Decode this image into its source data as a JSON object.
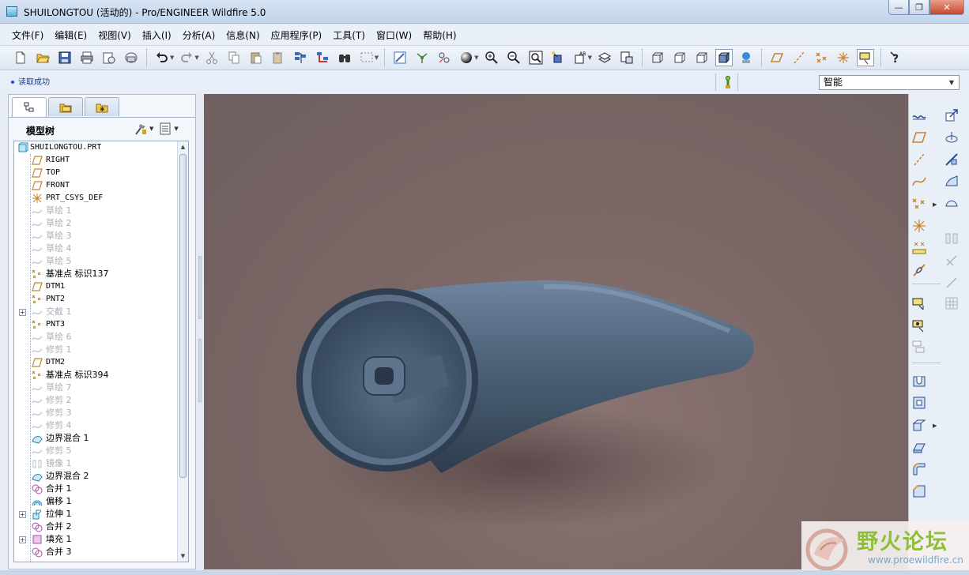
{
  "window": {
    "title": "SHUILONGTOU (活动的) - Pro/ENGINEER Wildfire 5.0",
    "minimize": "—",
    "maximize": "❐",
    "close": "✕"
  },
  "menu": [
    "文件(F)",
    "编辑(E)",
    "视图(V)",
    "插入(I)",
    "分析(A)",
    "信息(N)",
    "应用程序(P)",
    "工具(T)",
    "窗口(W)",
    "帮助(H)"
  ],
  "status": {
    "message": "读取成功",
    "filter_value": "智能"
  },
  "model_tree": {
    "header": "模型树",
    "items": [
      {
        "label": "SHUILONGTOU.PRT",
        "icon": "part-icon",
        "dim": false,
        "expand": false
      },
      {
        "label": "RIGHT",
        "icon": "datum-plane-icon",
        "dim": false,
        "expand": false
      },
      {
        "label": "TOP",
        "icon": "datum-plane-icon",
        "dim": false,
        "expand": false
      },
      {
        "label": "FRONT",
        "icon": "datum-plane-icon",
        "dim": false,
        "expand": false
      },
      {
        "label": "PRT_CSYS_DEF",
        "icon": "csys-icon",
        "dim": false,
        "expand": false
      },
      {
        "label": "草绘 1",
        "icon": "sketch-icon",
        "dim": true,
        "expand": false
      },
      {
        "label": "草绘 2",
        "icon": "sketch-icon",
        "dim": true,
        "expand": false
      },
      {
        "label": "草绘 3",
        "icon": "sketch-icon",
        "dim": true,
        "expand": false
      },
      {
        "label": "草绘 4",
        "icon": "sketch-icon",
        "dim": true,
        "expand": false
      },
      {
        "label": "草绘 5",
        "icon": "sketch-icon",
        "dim": true,
        "expand": false
      },
      {
        "label": "基准点 标识137",
        "icon": "datum-point-icon",
        "dim": false,
        "expand": false
      },
      {
        "label": "DTM1",
        "icon": "datum-plane-icon",
        "dim": false,
        "expand": false
      },
      {
        "label": "PNT2",
        "icon": "datum-point-icon",
        "dim": false,
        "expand": false
      },
      {
        "label": "交截 1",
        "icon": "intersect-icon",
        "dim": true,
        "expand": true
      },
      {
        "label": "PNT3",
        "icon": "datum-point-icon",
        "dim": false,
        "expand": false
      },
      {
        "label": "草绘 6",
        "icon": "sketch-icon",
        "dim": true,
        "expand": false
      },
      {
        "label": "修剪 1",
        "icon": "trim-icon",
        "dim": true,
        "expand": false
      },
      {
        "label": "DTM2",
        "icon": "datum-plane-icon",
        "dim": false,
        "expand": false
      },
      {
        "label": "基准点 标识394",
        "icon": "datum-point-icon",
        "dim": false,
        "expand": false
      },
      {
        "label": "草绘 7",
        "icon": "sketch-icon",
        "dim": true,
        "expand": false
      },
      {
        "label": "修剪 2",
        "icon": "trim-icon",
        "dim": true,
        "expand": false
      },
      {
        "label": "修剪 3",
        "icon": "trim-icon",
        "dim": true,
        "expand": false
      },
      {
        "label": "修剪 4",
        "icon": "trim-icon",
        "dim": true,
        "expand": false
      },
      {
        "label": "边界混合 1",
        "icon": "boundary-blend-icon",
        "dim": false,
        "expand": false
      },
      {
        "label": "修剪 5",
        "icon": "trim-icon",
        "dim": true,
        "expand": false
      },
      {
        "label": "镜像 1",
        "icon": "mirror-icon",
        "dim": true,
        "expand": false
      },
      {
        "label": "边界混合 2",
        "icon": "boundary-blend-icon",
        "dim": false,
        "expand": false
      },
      {
        "label": "合并 1",
        "icon": "merge-icon",
        "dim": false,
        "expand": false
      },
      {
        "label": "偏移 1",
        "icon": "offset-icon",
        "dim": false,
        "expand": false
      },
      {
        "label": "拉伸 1",
        "icon": "extrude-icon",
        "dim": false,
        "expand": true
      },
      {
        "label": "合并 2",
        "icon": "merge-icon",
        "dim": false,
        "expand": false
      },
      {
        "label": "填充 1",
        "icon": "fill-icon",
        "dim": false,
        "expand": true
      },
      {
        "label": "合并 3",
        "icon": "merge-icon",
        "dim": false,
        "expand": false
      }
    ]
  },
  "watermark": {
    "brand": "野火论坛",
    "url": "www.proewildfire.cn"
  },
  "colors": {
    "viewport_bg": "#7c6866",
    "model_color": "#4f6378",
    "accent_blue": "#1a52c8"
  }
}
